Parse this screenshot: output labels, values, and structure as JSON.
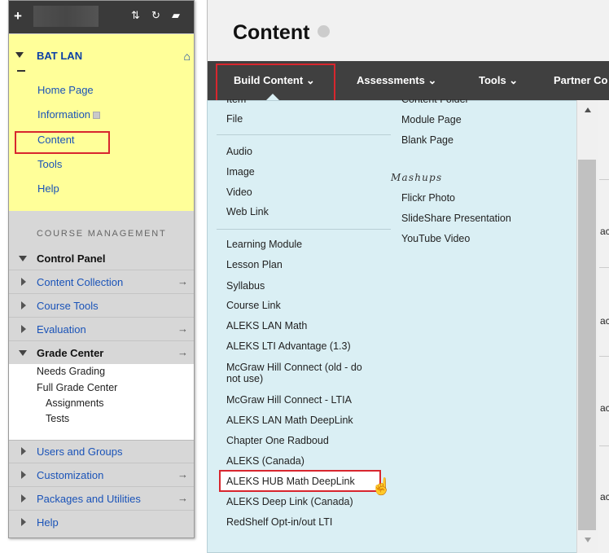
{
  "colors": {
    "highlight_box": "#d8262e",
    "course_menu_bg": "#ffff99",
    "link": "#1a53b8",
    "navbar_bg": "#404040",
    "dropdown_bg": "#daeff4"
  },
  "sidebar": {
    "topbar_icons": [
      "plus-icon",
      "sort-icon",
      "refresh-icon",
      "folder-icon"
    ],
    "course_title": "BAT LAN",
    "course_links": [
      {
        "label": "Home Page"
      },
      {
        "label": "Information"
      },
      {
        "label": "Content",
        "highlighted": true
      },
      {
        "label": "Tools"
      },
      {
        "label": "Help"
      }
    ],
    "course_management_heading": "COURSE MANAGEMENT",
    "control_panel": "Control Panel",
    "items": [
      {
        "label": "Content Collection",
        "arrow": "→"
      },
      {
        "label": "Course Tools"
      },
      {
        "label": "Evaluation",
        "arrow": "→"
      },
      {
        "label": "Grade Center",
        "arrow": "→"
      },
      {
        "label": "Users and Groups"
      },
      {
        "label": "Customization",
        "arrow": "→"
      },
      {
        "label": "Packages and Utilities",
        "arrow": "→"
      },
      {
        "label": "Help"
      }
    ],
    "grade_center_sub": [
      "Needs Grading",
      "Full Grade Center",
      "Assignments",
      "Tests"
    ]
  },
  "page": {
    "title": "Content",
    "nav": [
      {
        "label": "Build Content ⌄",
        "highlighted": true
      },
      {
        "label": "Assessments ⌄"
      },
      {
        "label": "Tools ⌄"
      },
      {
        "label": "Partner Co"
      }
    ],
    "row_fragments": [
      "ac",
      "ac",
      "ac",
      "ac"
    ]
  },
  "dropdown": {
    "col1_cut": "Item",
    "col1": [
      "File",
      "Audio",
      "Image",
      "Video",
      "Web Link",
      "Learning Module",
      "Lesson Plan",
      "Syllabus",
      "Course Link",
      "ALEKS LAN Math",
      "ALEKS LTI Advantage (1.3)",
      "McGraw Hill Connect (old - do not use)",
      "McGraw Hill Connect - LTIA",
      "ALEKS LAN Math DeepLink",
      "Chapter One Radboud",
      "ALEKS (Canada)",
      "ALEKS HUB Math DeepLink",
      "ALEKS Deep Link (Canada)",
      "RedShelf Opt-in/out LTI"
    ],
    "col2_cut": "Content Folder",
    "col2": [
      "Module Page",
      "Blank Page"
    ],
    "mashups_heading": "Mashups",
    "mashups": [
      "Flickr Photo",
      "SlideShare Presentation",
      "YouTube Video"
    ],
    "selected": "ALEKS HUB Math DeepLink"
  }
}
